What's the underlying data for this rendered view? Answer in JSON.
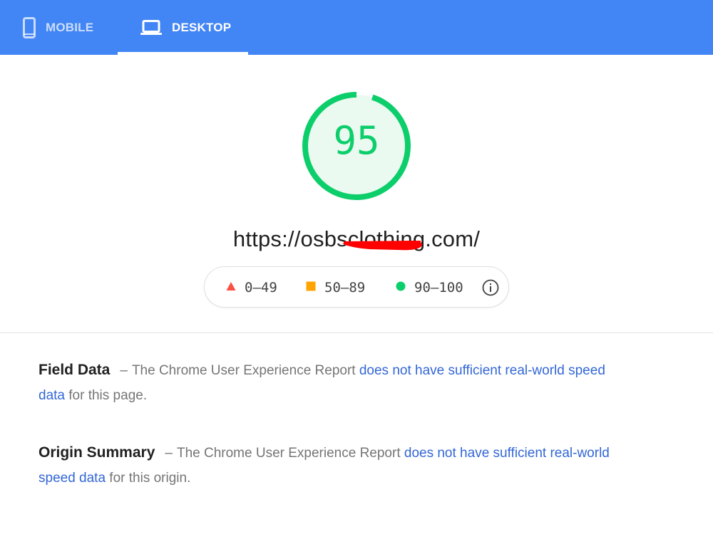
{
  "colors": {
    "brand": "#4285f4",
    "good": "#0cce6b",
    "average": "#ffa400",
    "fail": "#ff4e42",
    "link": "#3367d6",
    "redaction": "#ff0000"
  },
  "tabs": [
    {
      "label": "MOBILE",
      "icon": "mobile-phone-icon",
      "active": false
    },
    {
      "label": "DESKTOP",
      "icon": "laptop-icon",
      "active": true
    }
  ],
  "score": {
    "value": "95",
    "fraction": 0.95
  },
  "url": "https://osbsclothing.com/",
  "legend": {
    "fail": {
      "icon": "triangle-icon",
      "range": "0–49"
    },
    "average": {
      "icon": "square-icon",
      "range": "50–89"
    },
    "pass": {
      "icon": "circle-icon",
      "range": "90–100"
    },
    "info_icon": "info-icon"
  },
  "field_data": {
    "heading": "Field Data",
    "dash": "–",
    "text_before": "The Chrome User Experience Report ",
    "link": "does not have sufficient real-world speed data",
    "text_after": " for this page."
  },
  "origin_summary": {
    "heading": "Origin Summary",
    "dash": "–",
    "text_before": "The Chrome User Experience Report ",
    "link": "does not have sufficient real-world speed data",
    "text_after": " for this origin."
  }
}
